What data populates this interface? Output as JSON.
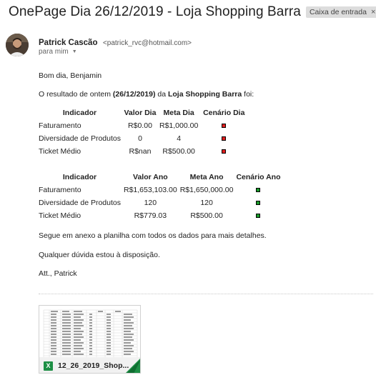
{
  "email": {
    "subject": "OnePage Dia 26/12/2019 - Loja Shopping Barra",
    "label": "Caixa de entrada",
    "label_remove": "×",
    "sender_name": "Patrick Cascão",
    "sender_email": "<patrick_rvc@hotmail.com>",
    "recipient": "para mim",
    "greeting": "Bom dia, Benjamin",
    "intro_prefix": "O resultado de ontem ",
    "intro_date": "(26/12/2019)",
    "intro_mid": " da ",
    "intro_store": "Loja Shopping Barra",
    "intro_suffix": " foi:",
    "attachment_note": "Segue em anexo a planilha com todos os dados para mais detalhes.",
    "closing_question": "Qualquer dúvida estou à disposição.",
    "signature": "Att., Patrick"
  },
  "table_day": {
    "headers": [
      "Indicador",
      "Valor Dia",
      "Meta Dia",
      "Cenário Dia"
    ],
    "rows": [
      {
        "indicator": "Faturamento",
        "value": "R$0.00",
        "target": "R$1,000.00",
        "status": "red"
      },
      {
        "indicator": "Diversidade de Produtos",
        "value": "0",
        "target": "4",
        "status": "red"
      },
      {
        "indicator": "Ticket Médio",
        "value": "R$nan",
        "target": "R$500.00",
        "status": "red"
      }
    ]
  },
  "table_year": {
    "headers": [
      "Indicador",
      "Valor Ano",
      "Meta Ano",
      "Cenário Ano"
    ],
    "rows": [
      {
        "indicator": "Faturamento",
        "value": "R$1,653,103.00",
        "target": "R$1,650,000.00",
        "status": "green"
      },
      {
        "indicator": "Diversidade de Produtos",
        "value": "120",
        "target": "120",
        "status": "green"
      },
      {
        "indicator": "Ticket Médio",
        "value": "R$779.03",
        "target": "R$500.00",
        "status": "green"
      }
    ]
  },
  "attachment": {
    "filename": "12_26_2019_Shop...",
    "icon": "excel-icon",
    "icon_letter": "X"
  },
  "colors": {
    "status_red": "#e02020",
    "status_green": "#1a9a2a",
    "excel_green": "#1d8f45"
  }
}
